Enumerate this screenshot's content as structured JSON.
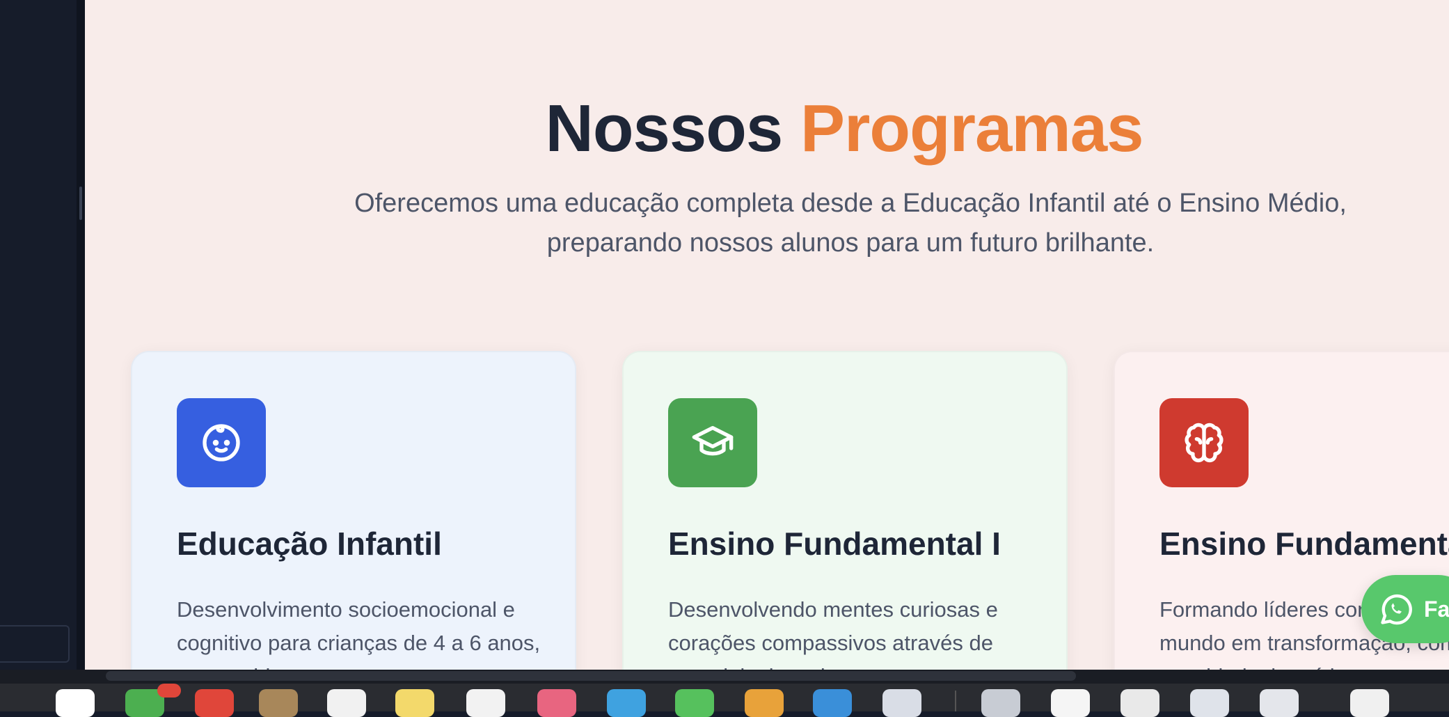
{
  "section": {
    "title_part1": "Nossos",
    "title_part2": "Programas",
    "subtitle": "Oferecemos uma educação completa desde a Educação Infantil até o Ensino Médio, preparando nossos alunos para um futuro brilhante."
  },
  "cards": [
    {
      "icon": "baby-icon",
      "title": "Educação Infantil",
      "text": "Desenvolvimento socioemocional e cognitivo para crianças de 4 a 6 anos, com ambiente seguro e"
    },
    {
      "icon": "graduation-cap-icon",
      "title": "Ensino Fundamental I",
      "text": "Desenvolvendo mentes curiosas e corações compassivos através de metodologias ativas e pensamento"
    },
    {
      "icon": "brain-icon",
      "title": "Ensino Fundamental II",
      "text": "Formando líderes conscientes para um mundo em transformação, com foco em cidadania e ética"
    }
  ],
  "whatsapp": {
    "icon": "whatsapp-icon",
    "label": "Fale"
  },
  "colors": {
    "accent": "#eb7f39",
    "heading": "#1e2637",
    "page_bg": "#f8ecea",
    "card1_icon_bg": "#365fe0",
    "card2_icon_bg": "#4aa352",
    "card3_icon_bg": "#cf3a2f",
    "whatsapp": "#58c86c"
  }
}
